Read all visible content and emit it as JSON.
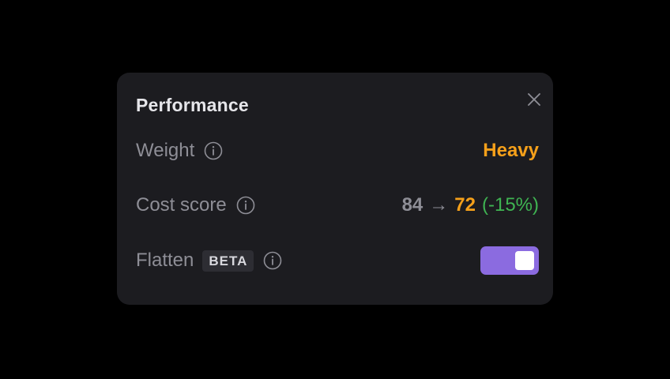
{
  "panel": {
    "title": "Performance",
    "close_icon": "close-icon"
  },
  "rows": {
    "weight": {
      "label": "Weight",
      "value": "Heavy",
      "value_color": "#f5a01a"
    },
    "cost": {
      "label": "Cost score",
      "from": "84",
      "arrow": "→",
      "to": "72",
      "delta": "(-15%)",
      "to_color": "#f5a01a",
      "delta_color": "#3fb452"
    },
    "flatten": {
      "label": "Flatten",
      "badge": "BETA",
      "toggle_on": true,
      "toggle_color": "#8b6be0"
    }
  },
  "icons": {
    "info": "info-circle-icon",
    "close": "close-icon"
  }
}
